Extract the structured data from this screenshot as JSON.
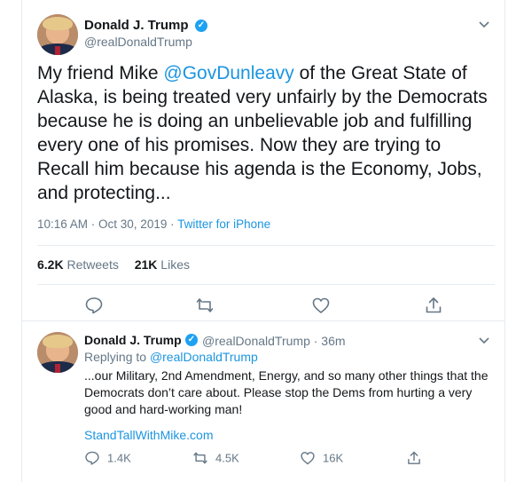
{
  "main_tweet": {
    "display_name": "Donald J. Trump",
    "handle": "@realDonaldTrump",
    "text_prefix": "My friend Mike ",
    "mention": "@GovDunleavy",
    "text_suffix": " of the Great State of Alaska, is being treated very unfairly by the Democrats because he is doing an unbelievable job and fulfilling every one of his promises. Now they are trying to Recall him because his agenda is the Economy, Jobs, and protecting...",
    "time": "10:16 AM · Oct 30, 2019 · ",
    "source": "Twitter for iPhone",
    "retweets_count": "6.2K",
    "retweets_label": "Retweets",
    "likes_count": "21K",
    "likes_label": "Likes"
  },
  "reply_tweet": {
    "display_name": "Donald J. Trump",
    "handle_time": "@realDonaldTrump · 36m",
    "replying_prefix": "Replying to ",
    "replying_handle": "@realDonaldTrump",
    "text": "...our Military, 2nd Amendment, Energy, and so many other things that the Democrats don’t care about. Please stop the Dems from hurting a very good and hard-working man!",
    "link": "StandTallWithMike.com",
    "replies": "1.4K",
    "retweets": "4.5K",
    "likes": "16K"
  },
  "icons": [
    "chevron-down-icon",
    "verified-icon",
    "reply-icon",
    "retweet-icon",
    "like-icon",
    "share-icon"
  ],
  "colors": {
    "accent": "#1b95e0",
    "verified": "#1da1f2",
    "muted": "#657786",
    "divider": "#e6ecf0"
  }
}
